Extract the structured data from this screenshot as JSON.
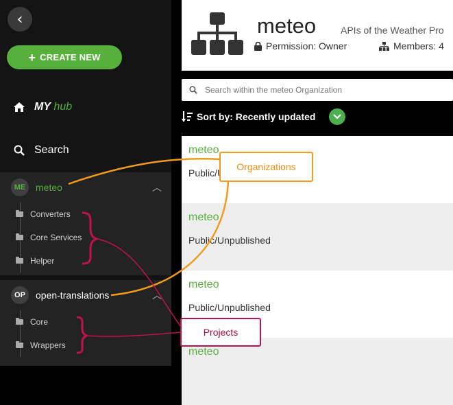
{
  "sidebar": {
    "create_label": "CREATE NEW",
    "nav_my": "MY",
    "nav_hub": "hub",
    "nav_search": "Search",
    "orgs": [
      {
        "initials": "ME",
        "name": "meteo",
        "projects": [
          "Converters",
          "Core Services",
          "Helper"
        ]
      },
      {
        "initials": "OP",
        "name": "open-translations",
        "projects": [
          "Core",
          "Wrappers"
        ]
      }
    ]
  },
  "header": {
    "title": "meteo",
    "description": "APIs of the Weather Pro",
    "permission": "Permission: Owner",
    "members": "Members: 4"
  },
  "search": {
    "placeholder": "Search within the meteo Organization"
  },
  "sort": {
    "label": "Sort by: Recently updated"
  },
  "projects": [
    {
      "name": "meteo",
      "status": "Public/Unpublished"
    },
    {
      "name": "meteo",
      "status": "Public/Unpublished"
    },
    {
      "name": "meteo",
      "status": "Public/Unpublished"
    },
    {
      "name": "meteo",
      "status": ""
    }
  ],
  "annotations": {
    "organizations": "Organizations",
    "projects": "Projects"
  },
  "colors": {
    "accent": "#58b03c",
    "org_callout": "#f39a1b",
    "proj_callout": "#c0134a"
  }
}
